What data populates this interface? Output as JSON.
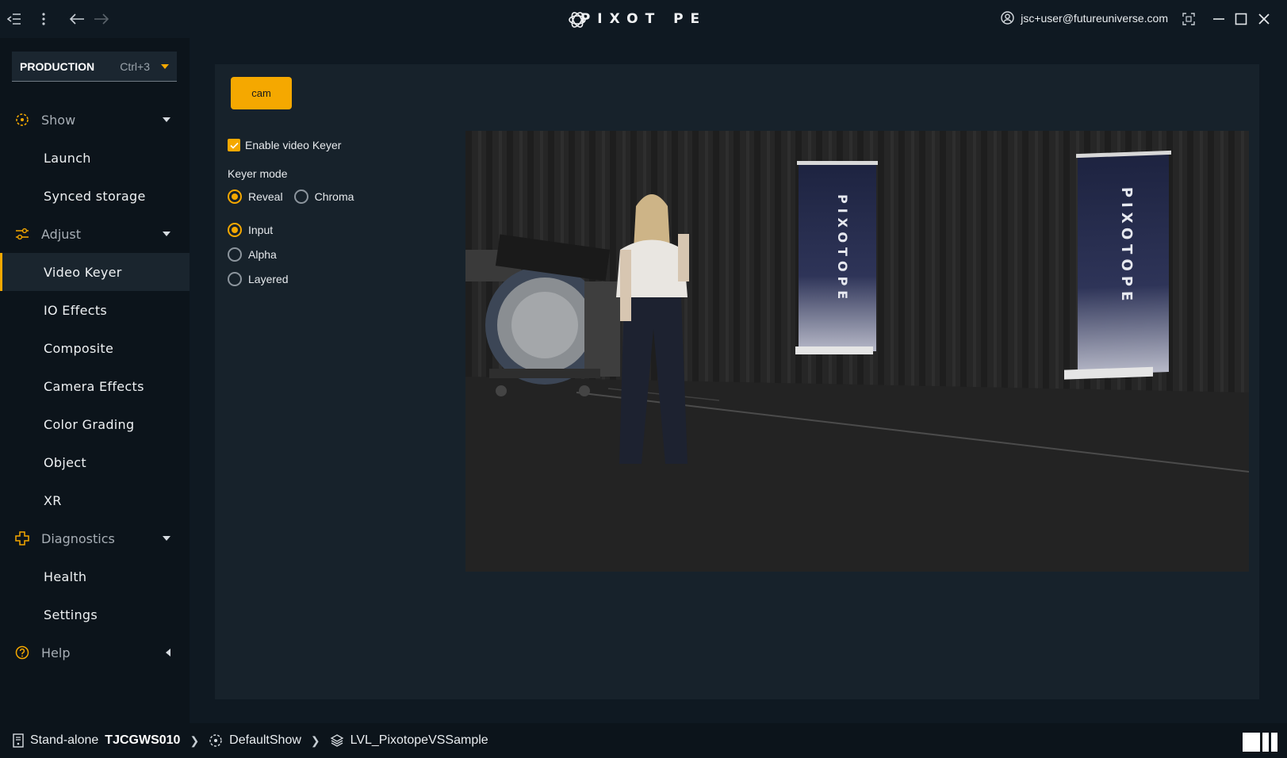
{
  "titlebar": {
    "logo": "PIXOT PE",
    "user_email": "jsc+user@futureuniverse.com",
    "icons": [
      "sidebar-collapse-icon",
      "more-vertical-icon",
      "back-arrow-icon",
      "forward-arrow-icon",
      "user-icon",
      "fullscreen-icon",
      "minimize-icon",
      "maximize-icon",
      "close-icon"
    ]
  },
  "sidebar": {
    "mode": {
      "label": "PRODUCTION",
      "shortcut": "Ctrl+3"
    },
    "sections": [
      {
        "label": "Show",
        "icon": "show-icon",
        "items": [
          "Launch",
          "Synced storage"
        ]
      },
      {
        "label": "Adjust",
        "icon": "sliders-icon",
        "items": [
          "Video Keyer",
          "IO Effects",
          "Composite",
          "Camera Effects",
          "Color Grading",
          "Object",
          "XR"
        ]
      },
      {
        "label": "Diagnostics",
        "icon": "diagnostics-icon",
        "items": [
          "Health",
          "Settings"
        ]
      },
      {
        "label": "Help",
        "icon": "help-icon",
        "items": []
      }
    ],
    "active_item": "Video Keyer"
  },
  "main": {
    "camera_button": "cam",
    "keyer": {
      "enable_label": "Enable video Keyer",
      "enabled": true,
      "mode_label": "Keyer mode",
      "modes": [
        "Reveal",
        "Chroma"
      ],
      "selected_mode": "Reveal",
      "views": [
        "Input",
        "Alpha",
        "Layered"
      ],
      "selected_view": "Input"
    }
  },
  "statusbar": {
    "mode": "Stand-alone",
    "machine": "TJCGWS010",
    "show": "DefaultShow",
    "level": "LVL_PixotopeVSSample"
  },
  "colors": {
    "accent": "#f5a800",
    "background": "#0f1922",
    "panel": "#17222b",
    "sidebar": "#0c141b"
  }
}
